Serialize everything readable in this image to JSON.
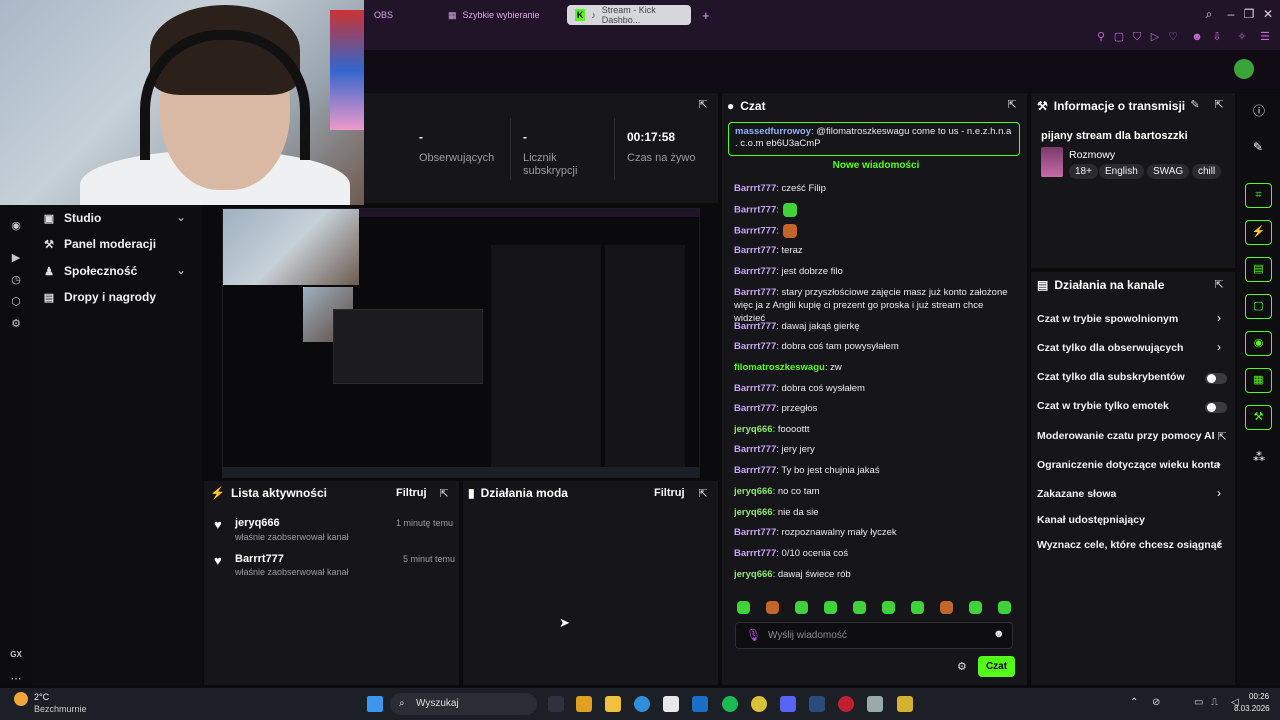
{
  "browser": {
    "tabs": [
      {
        "label": "OBS"
      },
      {
        "label": "Szybkie wybieranie"
      },
      {
        "label": "Stream - Kick Dashbo..."
      }
    ]
  },
  "sidebar": {
    "items": [
      {
        "label": "Studio"
      },
      {
        "label": "Panel moderacji"
      },
      {
        "label": "Społeczność"
      },
      {
        "label": "Dropy i nagrody"
      }
    ],
    "gx_label": "GX"
  },
  "stats": {
    "followers_value": "-",
    "followers_label": "Obserwujących",
    "subs_value": "-",
    "subs_label_1": "Licznik",
    "subs_label_2": "subskrypcji",
    "live_value": "00:17:58",
    "live_label": "Czas na żywo"
  },
  "activity": {
    "title": "Lista aktywności",
    "filter": "Filtruj",
    "items": [
      {
        "user": "jeryq666",
        "text": "właśnie zaobserwował kanał",
        "time": "1 minutę temu"
      },
      {
        "user": "Barrrt777",
        "text": "właśnie zaobserwował kanał",
        "time": "5 minut temu"
      }
    ]
  },
  "mod": {
    "title": "Działania moda",
    "filter": "Filtruj"
  },
  "chat": {
    "title": "Czat",
    "pinned_user": "massedfurrowoy",
    "pinned_text": ": @filomatroszkeswagu come to us - n.e.z.h.n.a . c.o.m eb6U3aCmP",
    "new_messages": "Nowe wiadomości",
    "messages": [
      {
        "user": "Barrrt777",
        "text": ": cześć Filip",
        "color": "#c9a6f5"
      },
      {
        "user": "Barrrt777",
        "text": ":",
        "color": "#c9a6f5",
        "emote": "#3fd23a"
      },
      {
        "user": "Barrrt777",
        "text": ":",
        "color": "#c9a6f5",
        "emote": "#c2652a"
      },
      {
        "user": "Barrrt777",
        "text": ": teraz",
        "color": "#c9a6f5"
      },
      {
        "user": "Barrrt777",
        "text": ": jest dobrze filo",
        "color": "#c9a6f5"
      },
      {
        "user": "Barrrt777",
        "text": ": stary przyszłościowe zajęcie masz już konto założone więc ja z Anglii kupię ci prezent go proska i już stream chce widzieć",
        "color": "#c9a6f5"
      },
      {
        "user": "Barrrt777",
        "text": ": dawaj jakąś gierkę",
        "color": "#c9a6f5"
      },
      {
        "user": "Barrrt777",
        "text": ": dobra coś tam powysyłałem",
        "color": "#c9a6f5"
      },
      {
        "user": "filomatroszkeswagu",
        "text": ": zw",
        "color": "#53fc18"
      },
      {
        "user": "Barrrt777",
        "text": ": dobra coś wysłałem",
        "color": "#c9a6f5"
      },
      {
        "user": "Barrrt777",
        "text": ": przegłos",
        "color": "#c9a6f5"
      },
      {
        "user": "jeryq666",
        "text": ": foooottt",
        "color": "#8ee86a"
      },
      {
        "user": "Barrrt777",
        "text": ": jery jery",
        "color": "#c9a6f5"
      },
      {
        "user": "Barrrt777",
        "text": ": Ty bo jest chujnia jakaś",
        "color": "#c9a6f5"
      },
      {
        "user": "jeryq666",
        "text": ": no co tam",
        "color": "#8ee86a"
      },
      {
        "user": "jeryq666",
        "text": ": nie da sie",
        "color": "#8ee86a"
      },
      {
        "user": "Barrrt777",
        "text": ": rozpoznawalny mały łyczek",
        "color": "#c9a6f5"
      },
      {
        "user": "Barrrt777",
        "text": ": 0/10 ocenia coś",
        "color": "#c9a6f5"
      },
      {
        "user": "jeryq666",
        "text": ": dawaj świece rób",
        "color": "#8ee86a"
      }
    ],
    "input_placeholder": "Wyślij wiadomość",
    "send_label": "Czat"
  },
  "stream_info": {
    "title": "Informacje o transmisji",
    "stream_title": "pijany stream dla bartoszzki",
    "category": "Rozmowy",
    "tags": [
      "18+",
      "English",
      "SWAG",
      "chill"
    ]
  },
  "channel_actions": {
    "title": "Działania na kanale",
    "items": [
      {
        "label": "Czat w trybie spowolnionym",
        "control": "chevron"
      },
      {
        "label": "Czat tylko dla obserwujących",
        "control": "chevron"
      },
      {
        "label": "Czat tylko dla subskrybentów",
        "control": "toggle"
      },
      {
        "label": "Czat w trybie tylko emotek",
        "control": "toggle"
      },
      {
        "label": "Moderowanie czatu przy pomocy AI",
        "control": "external"
      },
      {
        "label": "Ograniczenie dotyczące wieku konta",
        "control": "chevron"
      },
      {
        "label": "Zakazane słowa",
        "control": "chevron"
      },
      {
        "label": "Kanał udostępniający",
        "control": "none"
      },
      {
        "label": "Wyznacz cele, które chcesz osiągnąć",
        "control": "chevron"
      }
    ]
  },
  "taskbar": {
    "weather_temp": "2°C",
    "weather_desc": "Bezchmurnie",
    "search_placeholder": "Wyszukaj",
    "time": "00:26",
    "date": "8.03.2026"
  },
  "colors": {
    "accent": "#53fc18",
    "panel": "#16161a",
    "background": "#0b0b0e"
  }
}
